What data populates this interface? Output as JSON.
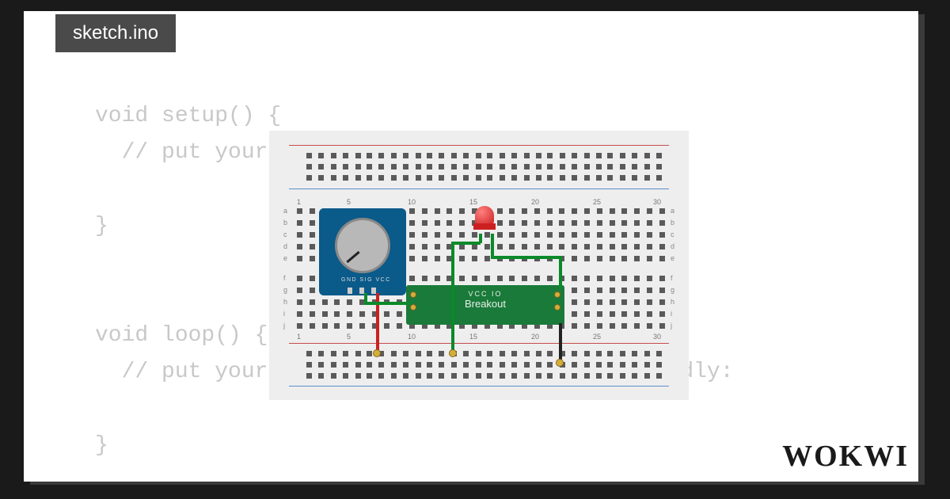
{
  "file_tab": "sketch.ino",
  "code": "void setup() {\n  // put your setup code here, to run once:\n\n}\n\n\nvoid loop() {\n  // put your main code here, to run repeatedly:\n\n}",
  "potentiometer": {
    "pin_labels": "GND SIG VCC"
  },
  "breakout": {
    "label_small": "VCC IO",
    "label_main": "Breakout"
  },
  "breadboard": {
    "col_numbers": [
      "1",
      "5",
      "10",
      "15",
      "20",
      "25",
      "30"
    ],
    "row_labels_top": "a\nb\nc\nd\ne",
    "row_labels_bot": "f\ng\nh\ni\nj"
  },
  "logo": "WOKWI"
}
